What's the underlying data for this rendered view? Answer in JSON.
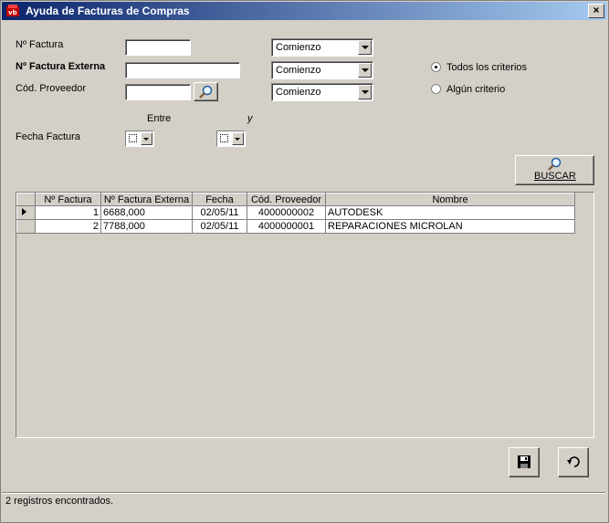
{
  "window": {
    "title": "Ayuda de Facturas de Compras",
    "close": "×"
  },
  "form": {
    "num_factura_label": "Nº Factura",
    "num_factura_ext_label": "Nº Factura Externa",
    "cod_proveedor_label": "Cód. Proveedor",
    "num_factura_value": "",
    "num_factura_ext_value": "",
    "cod_proveedor_value": "",
    "match_1": "Comienzo",
    "match_2": "Comienzo",
    "match_3": "Comienzo",
    "entre_label": "Entre",
    "y_label": "y",
    "fecha_label": "Fecha Factura",
    "criteria_all": "Todos los criterios",
    "criteria_any": "Algún criterio",
    "criteria_selected": "all",
    "buscar_label": "BUSCAR"
  },
  "grid": {
    "columns": [
      "Nº Factura",
      "Nº Factura Externa",
      "Fecha",
      "Cód. Proveedor",
      "Nombre"
    ],
    "rows": [
      {
        "num": "1",
        "ext": "6688,000",
        "fecha": "02/05/11",
        "prov": "4000000002",
        "nombre": "AUTODESK",
        "current": true
      },
      {
        "num": "2",
        "ext": "7788,000",
        "fecha": "02/05/11",
        "prov": "4000000001",
        "nombre": "REPARACIONES MICROLAN",
        "current": false
      }
    ]
  },
  "icons": {
    "buscar": "magnifier-icon",
    "lookup": "magnifier-icon",
    "save": "floppy-disk-icon",
    "undo": "undo-arrow-icon"
  },
  "colors": {
    "titlebar_start": "#0a246a",
    "titlebar_end": "#a6caf0",
    "face": "#d4d0c8"
  },
  "status": {
    "text": "2 registros encontrados."
  }
}
